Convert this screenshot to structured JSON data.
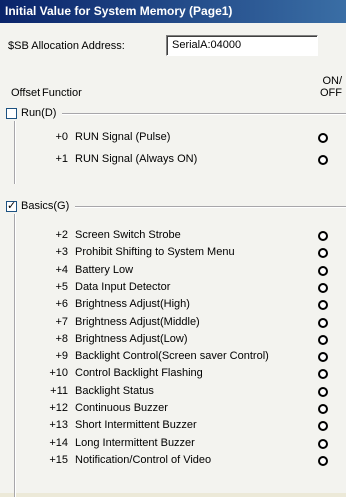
{
  "window": {
    "title": "Initial Value for System Memory (Page1)"
  },
  "allocation": {
    "label": "$SB Allocation Address:",
    "value": "SerialA:04000"
  },
  "columns": {
    "offset": "Offset",
    "function": "Functior",
    "on": "ON/",
    "off": "OFF"
  },
  "groups": [
    {
      "name": "Run(D)",
      "checked": false,
      "items": [
        {
          "offset": "+0",
          "label": "RUN Signal (Pulse)"
        },
        {
          "offset": "+1",
          "label": "RUN Signal (Always ON)"
        }
      ]
    },
    {
      "name": "Basics(G)",
      "checked": true,
      "items": [
        {
          "offset": "+2",
          "label": "Screen Switch Strobe"
        },
        {
          "offset": "+3",
          "label": "Prohibit Shifting to System Menu"
        },
        {
          "offset": "+4",
          "label": "Battery Low"
        },
        {
          "offset": "+5",
          "label": "Data Input Detector"
        },
        {
          "offset": "+6",
          "label": "Brightness Adjust(High)"
        },
        {
          "offset": "+7",
          "label": "Brightness Adjust(Middle)"
        },
        {
          "offset": "+8",
          "label": "Brightness Adjust(Low)"
        },
        {
          "offset": "+9",
          "label": "Backlight Control(Screen saver Control)"
        },
        {
          "offset": "+10",
          "label": "Control Backlight Flashing"
        },
        {
          "offset": "+11",
          "label": "Backlight Status"
        },
        {
          "offset": "+12",
          "label": "Continuous Buzzer"
        },
        {
          "offset": "+13",
          "label": "Short Intermittent Buzzer"
        },
        {
          "offset": "+14",
          "label": "Long Intermittent Buzzer"
        },
        {
          "offset": "+15",
          "label": "Notification/Control of Video"
        }
      ]
    }
  ]
}
